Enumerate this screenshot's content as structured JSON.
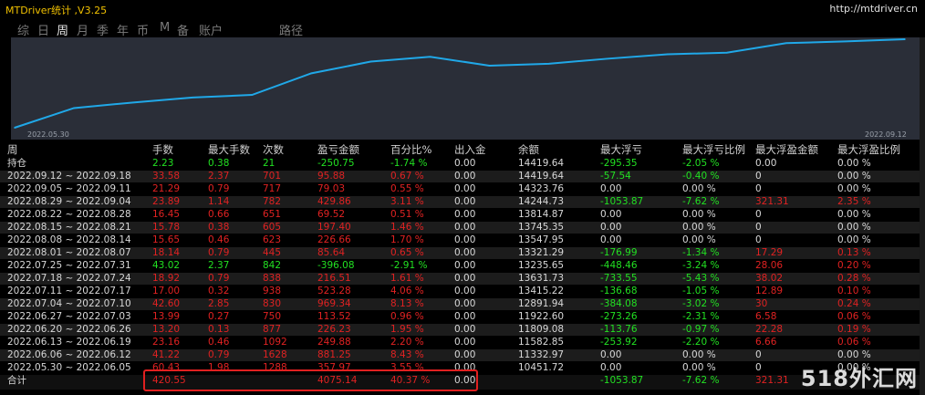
{
  "window": {
    "title": "MTDriver统计 ,V3.25",
    "site": "http://mtdriver.cn"
  },
  "tabs": [
    {
      "label": "综",
      "active": false
    },
    {
      "label": "日",
      "active": false
    },
    {
      "label": "周",
      "active": true
    },
    {
      "label": "月",
      "active": false
    },
    {
      "label": "季",
      "active": false
    },
    {
      "label": "年",
      "active": false
    },
    {
      "label": "币",
      "active": false
    },
    {
      "label": "M",
      "active": false
    },
    {
      "label": "备",
      "active": false
    },
    {
      "label": "账户",
      "active": false
    },
    {
      "label": "路径",
      "active": false
    }
  ],
  "chart_data": {
    "type": "line",
    "x_start_label": "2022.05.30",
    "x_end_label": "2022.09.12",
    "series": [
      {
        "values": [
          10451.72,
          11332.97,
          11582.85,
          11809.08,
          11922.6,
          12891.94,
          13415.22,
          13631.73,
          13235.65,
          13321.29,
          13547.95,
          13745.35,
          13814.87,
          14244.73,
          14323.76,
          14419.64
        ]
      }
    ],
    "color": "#20a8e8",
    "background": "#2a2e38"
  },
  "table": {
    "headers": [
      "周",
      "手数",
      "最大手数",
      "次数",
      "盈亏金额",
      "百分比%",
      "出入金",
      "余额",
      "最大浮亏",
      "最大浮亏比例",
      "最大浮盈金额",
      "最大浮盈比例"
    ],
    "position_row": {
      "label": "持仓",
      "cells": [
        "2.23",
        "0.38",
        "21",
        "-250.75",
        "-1.74 %",
        "0.00",
        "14419.64",
        "-295.35",
        "-2.05 %",
        "0.00",
        "0.00 %"
      ],
      "color": "green"
    },
    "rows": [
      {
        "week": "2022.09.12 ~ 2022.09.18",
        "cells": [
          "33.58",
          "2.37",
          "701",
          "95.88",
          "0.67 %",
          "0.00",
          "14419.64",
          "-57.54",
          "-0.40 %",
          "0",
          "0.00 %"
        ],
        "color": "red"
      },
      {
        "week": "2022.09.05 ~ 2022.09.11",
        "cells": [
          "21.29",
          "0.79",
          "717",
          "79.03",
          "0.55 %",
          "0.00",
          "14323.76",
          "0.00",
          "0.00 %",
          "0",
          "0.00 %"
        ],
        "color": "red"
      },
      {
        "week": "2022.08.29 ~ 2022.09.04",
        "cells": [
          "23.89",
          "1.14",
          "782",
          "429.86",
          "3.11 %",
          "0.00",
          "14244.73",
          "-1053.87",
          "-7.62 %",
          "321.31",
          "2.35 %"
        ],
        "color": "red"
      },
      {
        "week": "2022.08.22 ~ 2022.08.28",
        "cells": [
          "16.45",
          "0.66",
          "651",
          "69.52",
          "0.51 %",
          "0.00",
          "13814.87",
          "0.00",
          "0.00 %",
          "0",
          "0.00 %"
        ],
        "color": "red"
      },
      {
        "week": "2022.08.15 ~ 2022.08.21",
        "cells": [
          "15.78",
          "0.38",
          "605",
          "197.40",
          "1.46 %",
          "0.00",
          "13745.35",
          "0.00",
          "0.00 %",
          "0",
          "0.00 %"
        ],
        "color": "red"
      },
      {
        "week": "2022.08.08 ~ 2022.08.14",
        "cells": [
          "15.65",
          "0.46",
          "623",
          "226.66",
          "1.70 %",
          "0.00",
          "13547.95",
          "0.00",
          "0.00 %",
          "0",
          "0.00 %"
        ],
        "color": "red"
      },
      {
        "week": "2022.08.01 ~ 2022.08.07",
        "cells": [
          "18.14",
          "0.79",
          "445",
          "85.64",
          "0.65 %",
          "0.00",
          "13321.29",
          "-176.99",
          "-1.34 %",
          "17.29",
          "0.13 %"
        ],
        "color": "red"
      },
      {
        "week": "2022.07.25 ~ 2022.07.31",
        "cells": [
          "43.02",
          "2.37",
          "842",
          "-396.08",
          "-2.91 %",
          "0.00",
          "13235.65",
          "-448.46",
          "-3.24 %",
          "28.06",
          "0.20 %"
        ],
        "color": "green"
      },
      {
        "week": "2022.07.18 ~ 2022.07.24",
        "cells": [
          "18.92",
          "0.79",
          "838",
          "216.51",
          "1.61 %",
          "0.00",
          "13631.73",
          "-733.55",
          "-5.43 %",
          "38.02",
          "0.28 %"
        ],
        "color": "red"
      },
      {
        "week": "2022.07.11 ~ 2022.07.17",
        "cells": [
          "17.00",
          "0.32",
          "938",
          "523.28",
          "4.06 %",
          "0.00",
          "13415.22",
          "-136.68",
          "-1.05 %",
          "12.89",
          "0.10 %"
        ],
        "color": "red"
      },
      {
        "week": "2022.07.04 ~ 2022.07.10",
        "cells": [
          "42.60",
          "2.85",
          "830",
          "969.34",
          "8.13 %",
          "0.00",
          "12891.94",
          "-384.08",
          "-3.02 %",
          "30",
          "0.24 %"
        ],
        "color": "red"
      },
      {
        "week": "2022.06.27 ~ 2022.07.03",
        "cells": [
          "13.99",
          "0.27",
          "750",
          "113.52",
          "0.96 %",
          "0.00",
          "11922.60",
          "-273.26",
          "-2.31 %",
          "6.58",
          "0.06 %"
        ],
        "color": "red"
      },
      {
        "week": "2022.06.20 ~ 2022.06.26",
        "cells": [
          "13.20",
          "0.13",
          "877",
          "226.23",
          "1.95 %",
          "0.00",
          "11809.08",
          "-113.76",
          "-0.97 %",
          "22.28",
          "0.19 %"
        ],
        "color": "red"
      },
      {
        "week": "2022.06.13 ~ 2022.06.19",
        "cells": [
          "23.16",
          "0.46",
          "1092",
          "249.88",
          "2.20 %",
          "0.00",
          "11582.85",
          "-253.92",
          "-2.20 %",
          "6.66",
          "0.06 %"
        ],
        "color": "red"
      },
      {
        "week": "2022.06.06 ~ 2022.06.12",
        "cells": [
          "41.22",
          "0.79",
          "1628",
          "881.25",
          "8.43 %",
          "0.00",
          "11332.97",
          "0.00",
          "0.00 %",
          "0",
          "0.00 %"
        ],
        "color": "red"
      },
      {
        "week": "2022.05.30 ~ 2022.06.05",
        "cells": [
          "60.43",
          "1.98",
          "1288",
          "357.97",
          "3.55 %",
          "0.00",
          "10451.72",
          "0.00",
          "0.00 %",
          "0",
          "0.00 %"
        ],
        "color": "red"
      }
    ],
    "total_row": {
      "label": "合计",
      "cells": [
        "420.55",
        "",
        "",
        "4075.14",
        "40.37 %",
        "0.00",
        "",
        "-1053.87",
        "-7.62 %",
        "321.31",
        ""
      ]
    }
  },
  "watermark": "518外汇网"
}
